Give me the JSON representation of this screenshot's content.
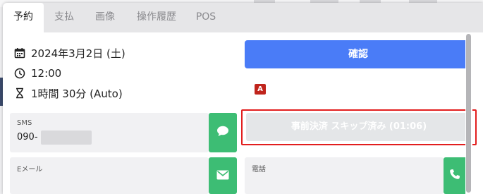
{
  "tabs": [
    "予約",
    "支払",
    "画像",
    "操作履歴",
    "POS"
  ],
  "booking": {
    "date": "2024年3月2日 (土)",
    "time": "12:00",
    "duration": "1時間 30分 (Auto)"
  },
  "confirm_button": "確認",
  "badge_letter": "A",
  "sms": {
    "label": "SMS",
    "value_prefix": "090-"
  },
  "email": {
    "label": "Eメール"
  },
  "phone": {
    "label": "電話"
  },
  "skip_button": "事前決済 スキップ済み (01:06)",
  "colors": {
    "confirm": "#4a7cf7",
    "green": "#3dbd74",
    "highlight": "#e21e1e",
    "badge": "#c0241c"
  }
}
